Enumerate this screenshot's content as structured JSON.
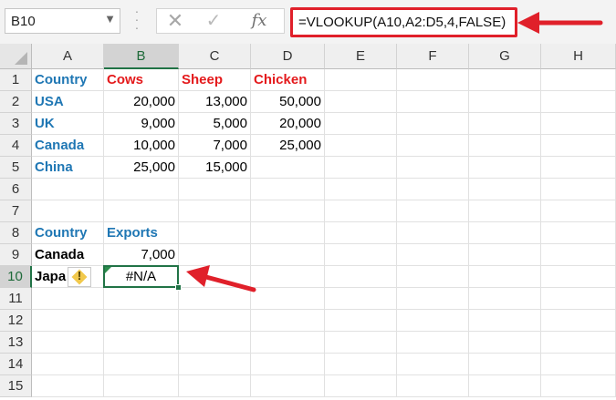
{
  "formula_bar": {
    "name_box": "B10",
    "cancel_icon": "x-icon",
    "enter_icon": "check-icon",
    "fx_label": "fx",
    "formula": "=VLOOKUP(A10,A2:D5,4,FALSE)"
  },
  "columns": [
    "A",
    "B",
    "C",
    "D",
    "E",
    "F",
    "G",
    "H"
  ],
  "rows": [
    "1",
    "2",
    "3",
    "4",
    "5",
    "6",
    "7",
    "8",
    "9",
    "10",
    "11",
    "12",
    "13",
    "14",
    "15"
  ],
  "selected": {
    "column": "B",
    "row": "10"
  },
  "cells": {
    "A1": "Country",
    "B1": "Cows",
    "C1": "Sheep",
    "D1": "Chicken",
    "A2": "USA",
    "B2": "20,000",
    "C2": "13,000",
    "D2": "50,000",
    "A3": "UK",
    "B3": "9,000",
    "C3": "5,000",
    "D3": "20,000",
    "A4": "Canada",
    "B4": "10,000",
    "C4": "7,000",
    "D4": "25,000",
    "A5": "China",
    "B5": "25,000",
    "C5": "15,000",
    "A8": "Country",
    "B8": "Exports",
    "A9": "Canada",
    "B9": "7,000",
    "A10": "Japa",
    "B10": "#N/A"
  },
  "warning_icon": "exclamation-warning-icon",
  "warning_symbol": "!",
  "colors": {
    "accent": "#217346",
    "header_blue": "#1f77b4",
    "header_red": "#e41a1c",
    "annotation_red": "#e0202a"
  }
}
